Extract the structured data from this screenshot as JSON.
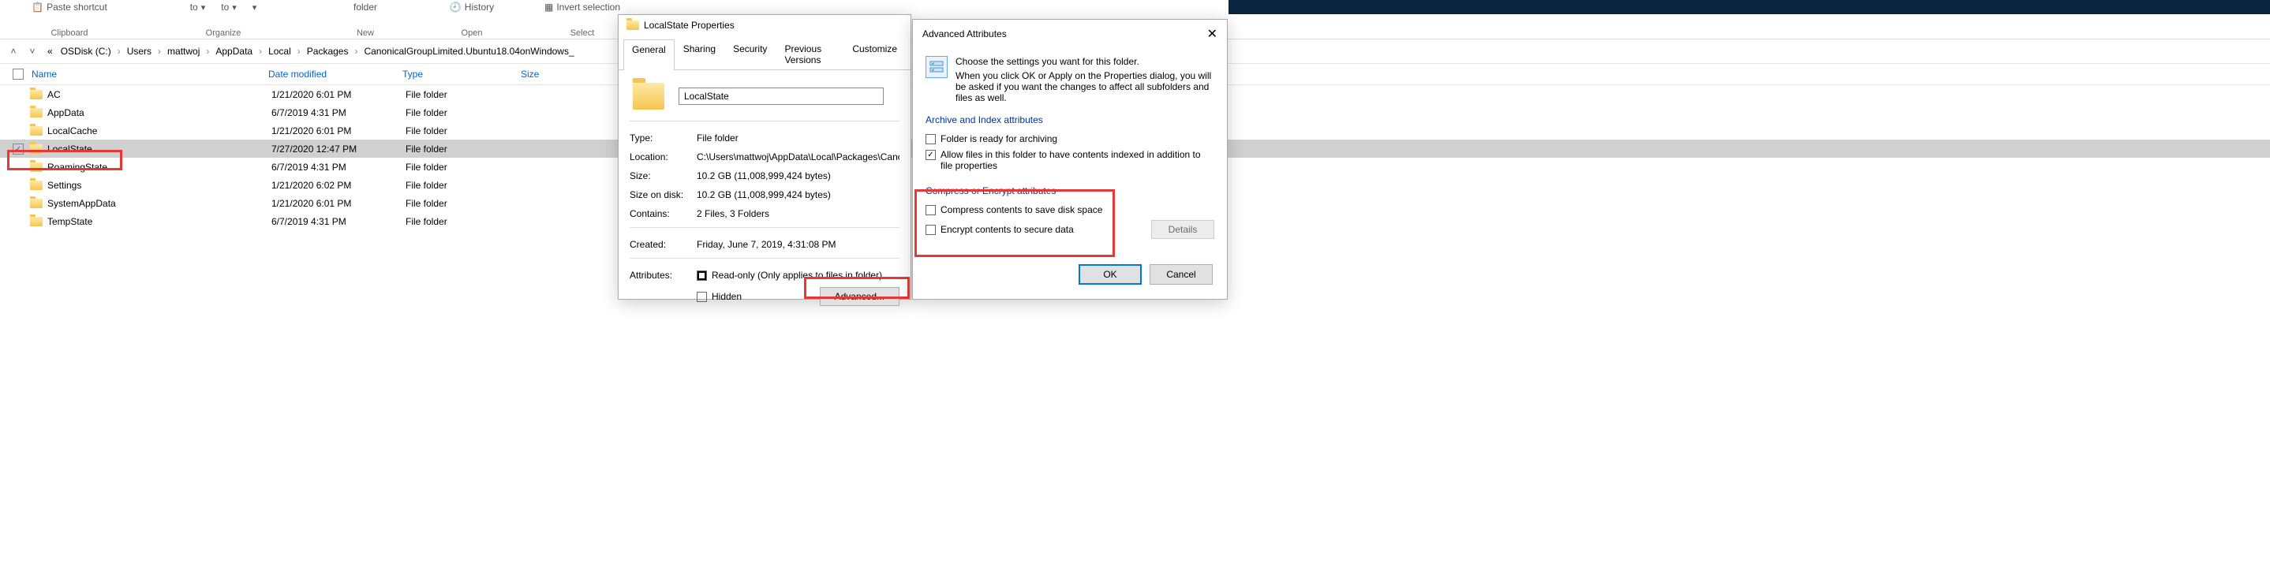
{
  "ribbon": {
    "paste_shortcut": "Paste shortcut",
    "move_to": "to",
    "copy_to": "to",
    "delete": "",
    "rename": "",
    "new_folder": "folder",
    "properties": "",
    "history": "History",
    "invert_selection": "Invert selection",
    "groups": {
      "clipboard": "Clipboard",
      "organize": "Organize",
      "new": "New",
      "open": "Open",
      "select": "Select"
    }
  },
  "breadcrumb": {
    "segments": [
      "«",
      "OSDisk (C:)",
      "Users",
      "mattwoj",
      "AppData",
      "Local",
      "Packages",
      "CanonicalGroupLimited.Ubuntu18.04onWindows_"
    ]
  },
  "columns": {
    "name": "Name",
    "date": "Date modified",
    "type": "Type",
    "size": "Size"
  },
  "rows": [
    {
      "name": "AC",
      "date": "1/21/2020 6:01 PM",
      "type": "File folder",
      "selected": false
    },
    {
      "name": "AppData",
      "date": "6/7/2019 4:31 PM",
      "type": "File folder",
      "selected": false
    },
    {
      "name": "LocalCache",
      "date": "1/21/2020 6:01 PM",
      "type": "File folder",
      "selected": false
    },
    {
      "name": "LocalState",
      "date": "7/27/2020 12:47 PM",
      "type": "File folder",
      "selected": true
    },
    {
      "name": "RoamingState",
      "date": "6/7/2019 4:31 PM",
      "type": "File folder",
      "selected": false
    },
    {
      "name": "Settings",
      "date": "1/21/2020 6:02 PM",
      "type": "File folder",
      "selected": false
    },
    {
      "name": "SystemAppData",
      "date": "1/21/2020 6:01 PM",
      "type": "File folder",
      "selected": false
    },
    {
      "name": "TempState",
      "date": "6/7/2019 4:31 PM",
      "type": "File folder",
      "selected": false
    }
  ],
  "properties": {
    "title": "LocalState Properties",
    "tabs": [
      "General",
      "Sharing",
      "Security",
      "Previous Versions",
      "Customize"
    ],
    "name_value": "LocalState",
    "fields": {
      "type_label": "Type:",
      "type_value": "File folder",
      "location_label": "Location:",
      "location_value": "C:\\Users\\mattwoj\\AppData\\Local\\Packages\\Canonic",
      "size_label": "Size:",
      "size_value": "10.2 GB (11,008,999,424 bytes)",
      "disk_label": "Size on disk:",
      "disk_value": "10.2 GB (11,008,999,424 bytes)",
      "contains_label": "Contains:",
      "contains_value": "2 Files, 3 Folders",
      "created_label": "Created:",
      "created_value": "Friday, June 7, 2019, 4:31:08 PM",
      "attributes_label": "Attributes:",
      "readonly": "Read-only (Only applies to files in folder)",
      "hidden": "Hidden",
      "advanced_btn": "Advanced..."
    }
  },
  "advanced": {
    "title": "Advanced Attributes",
    "intro1": "Choose the settings you want for this folder.",
    "intro2": "When you click OK or Apply on the Properties dialog, you will be asked if you want the changes to affect all subfolders and files as well.",
    "section1": "Archive and Index attributes",
    "opt_archive": "Folder is ready for archiving",
    "opt_index": "Allow files in this folder to have contents indexed in addition to file properties",
    "section2": "Compress or Encrypt attributes",
    "opt_compress": "Compress contents to save disk space",
    "opt_encrypt": "Encrypt contents to secure data",
    "details_btn": "Details",
    "ok_btn": "OK",
    "cancel_btn": "Cancel"
  }
}
